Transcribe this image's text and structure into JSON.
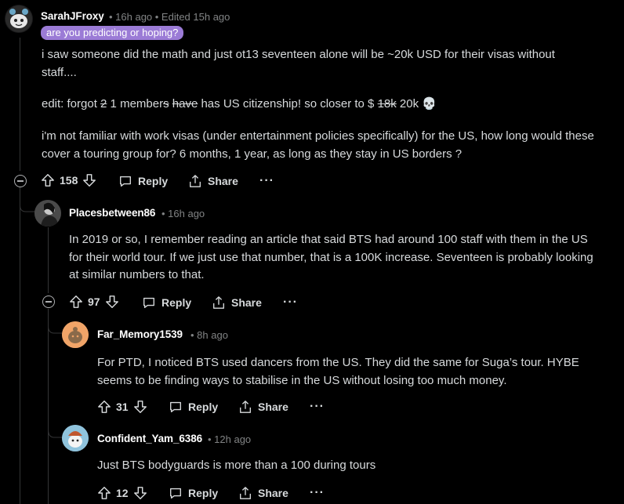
{
  "comments": [
    {
      "author": "SarahJFroxy",
      "meta": "• 16h ago • Edited 15h ago",
      "flair": "are you predicting or hoping?",
      "p1": "i saw someone did the math and just ot13 seventeen alone will be ~20k USD for their visas without staff....",
      "p2": {
        "a": "edit: forgot ",
        "b_strike": "2",
        "c": " 1 member",
        "d_strike": "s",
        "e": " ",
        "f_strike": "have",
        "g": " has US citizenship! so closer to $ ",
        "h_strike": "18k",
        "i": " 20k 💀"
      },
      "p3": "i'm not familiar with work visas (under entertainment policies specifically) for the US, how long would these cover a touring group for? 6 months, 1 year, as long as they stay in US borders ?",
      "score": "158",
      "reply_label": "Reply",
      "share_label": "Share",
      "more_label": "···"
    },
    {
      "author": "Placesbetween86",
      "meta": "• 16h ago",
      "text": "In 2019 or so, I remember reading an article that said BTS had around 100 staff with them in the US for their world tour. If we just use that number, that is a 100K increase. Seventeen is probably looking at similar numbers to that.",
      "score": "97",
      "reply_label": "Reply",
      "share_label": "Share",
      "more_label": "···"
    },
    {
      "author": "Far_Memory1539",
      "meta": "• 8h ago",
      "text": "For PTD, I noticed BTS used dancers from the US. They did the same for Suga’s tour. HYBE seems to be finding ways to stabilise in the US without losing too much money.",
      "score": "31",
      "reply_label": "Reply",
      "share_label": "Share",
      "more_label": "···"
    },
    {
      "author": "Confident_Yam_6386",
      "meta": "• 12h ago",
      "text": "Just BTS bodyguards is more than a 100 during tours",
      "score": "12",
      "reply_label": "Reply",
      "share_label": "Share",
      "more_label": "···"
    }
  ],
  "colors": {
    "background": "#000000",
    "text": "#d7dadc",
    "meta": "#818384",
    "flair": "#9b7bd6",
    "thread_line": "#343536"
  },
  "icons": [
    "snoo-avatar",
    "upvote-icon",
    "downvote-icon",
    "reply-icon",
    "share-icon",
    "more-icon",
    "collapse-icon"
  ]
}
